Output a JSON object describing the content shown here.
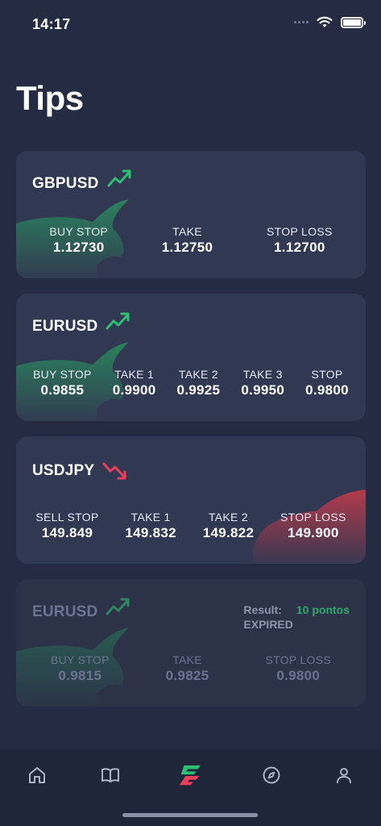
{
  "status_bar": {
    "time": "14:17"
  },
  "title": "Tips",
  "cards": [
    {
      "pair": "GBPUSD",
      "trend": "up",
      "columns": [
        {
          "label": "BUY STOP",
          "value": "1.12730"
        },
        {
          "label": "TAKE",
          "value": "1.12750"
        },
        {
          "label": "STOP LOSS",
          "value": "1.12700"
        }
      ]
    },
    {
      "pair": "EURUSD",
      "trend": "up",
      "columns": [
        {
          "label": "BUY STOP",
          "value": "0.9855"
        },
        {
          "label": "TAKE 1",
          "value": "0.9900"
        },
        {
          "label": "TAKE 2",
          "value": "0.9925"
        },
        {
          "label": "TAKE 3",
          "value": "0.9950"
        },
        {
          "label": "STOP",
          "value": "0.9800"
        }
      ]
    },
    {
      "pair": "USDJPY",
      "trend": "down",
      "columns": [
        {
          "label": "SELL STOP",
          "value": "149.849"
        },
        {
          "label": "TAKE 1",
          "value": "149.832"
        },
        {
          "label": "TAKE 2",
          "value": "149.822"
        },
        {
          "label": "STOP LOSS",
          "value": "149.900"
        }
      ]
    },
    {
      "pair": "EURUSD",
      "trend": "up",
      "result_label": "Result:",
      "result_points": "10 pontos",
      "result_status": "EXPIRED",
      "columns": [
        {
          "label": "BUY STOP",
          "value": "0.9815"
        },
        {
          "label": "TAKE",
          "value": "0.9825"
        },
        {
          "label": "STOP LOSS",
          "value": "0.9800"
        }
      ]
    }
  ],
  "tabbar": {
    "items": [
      {
        "icon": "home-icon"
      },
      {
        "icon": "book-icon"
      },
      {
        "icon": "tips-logo-icon",
        "active": true
      },
      {
        "icon": "compass-icon"
      },
      {
        "icon": "profile-icon"
      }
    ]
  },
  "colors": {
    "background": "#242b42",
    "card": "#313851",
    "up": "#2fbf71",
    "down": "#e8405a"
  }
}
